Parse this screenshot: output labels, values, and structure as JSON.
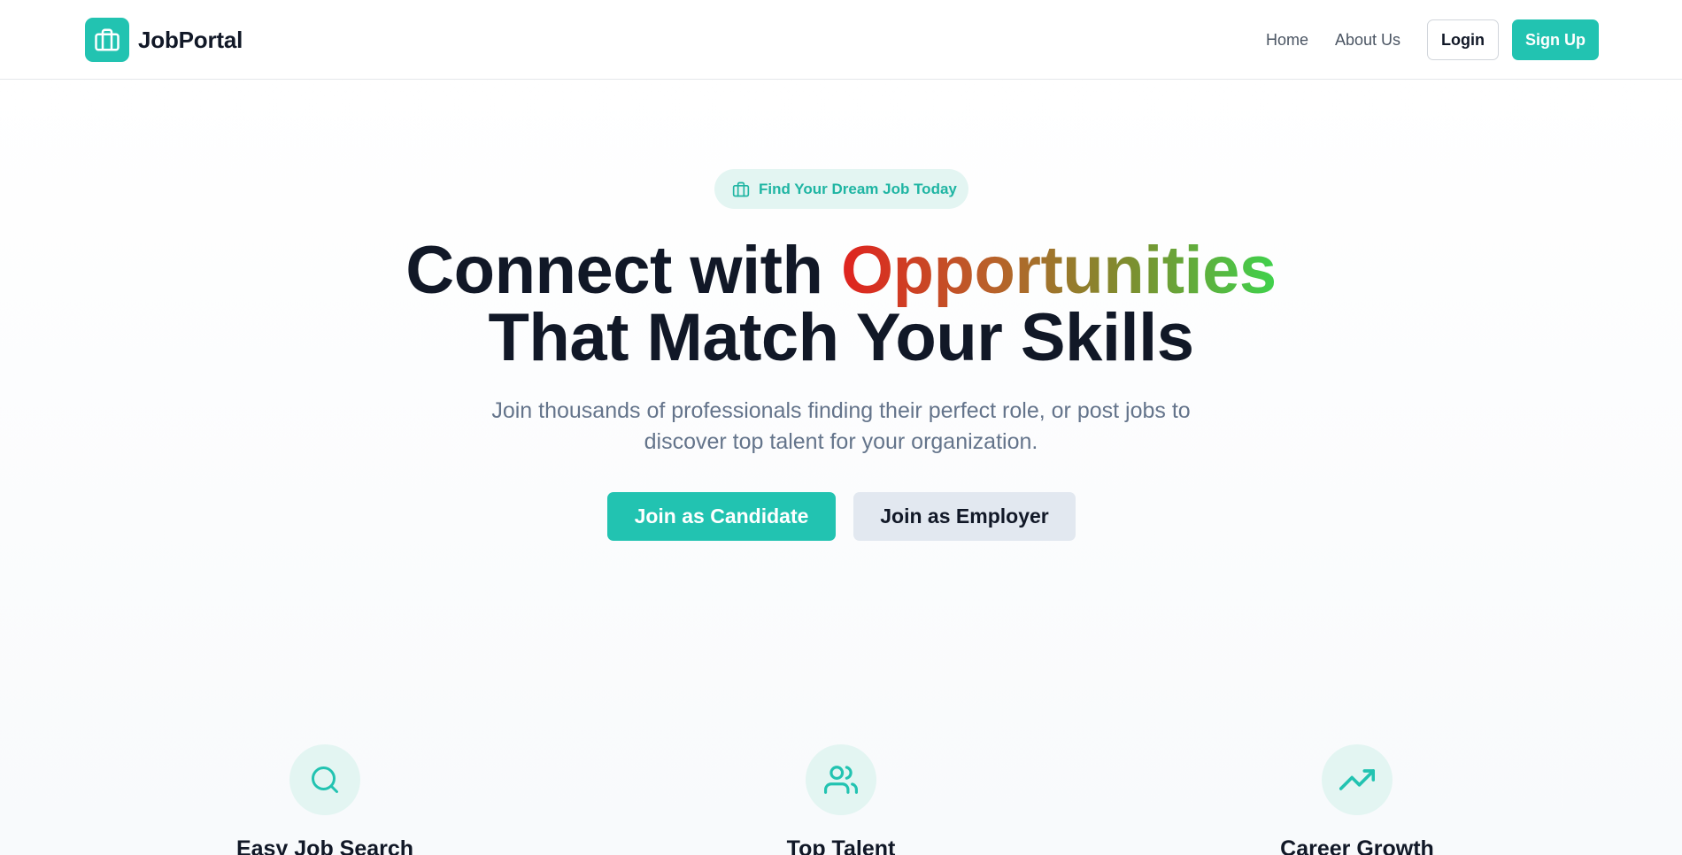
{
  "brand": {
    "name": "JobPortal",
    "logo_icon": "briefcase-icon",
    "accent": "#22c3b1"
  },
  "nav": {
    "home": "Home",
    "about": "About Us",
    "login": "Login",
    "signup": "Sign Up"
  },
  "hero": {
    "badge": "Find Your Dream Job Today",
    "badge_icon": "briefcase-icon",
    "title_part1": "Connect with ",
    "title_highlight": "Opportunities",
    "title_line2": "That Match Your Skills",
    "subtitle": "Join thousands of professionals finding their perfect role, or post jobs to discover top talent for your organization.",
    "cta_candidate": "Join as Candidate",
    "cta_employer": "Join as Employer"
  },
  "features": [
    {
      "icon": "search-icon",
      "title": "Easy Job Search"
    },
    {
      "icon": "users-icon",
      "title": "Top Talent"
    },
    {
      "icon": "trending-up-icon",
      "title": "Career Growth"
    }
  ]
}
